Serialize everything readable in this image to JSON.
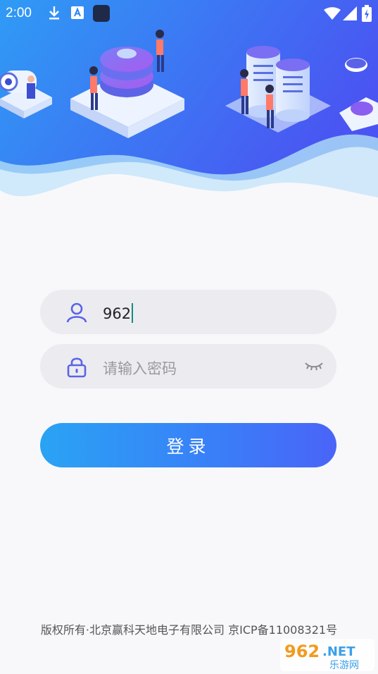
{
  "status_bar": {
    "time": "2:00",
    "icons": [
      "download-icon",
      "app-a-icon",
      "app-square-icon",
      "wifi-icon",
      "signal-icon",
      "battery-icon"
    ]
  },
  "hero": {
    "gradient_start": "#2f9bf5",
    "gradient_end": "#4a54f2",
    "illustration": "isometric-data-center-illustration"
  },
  "login": {
    "username_value": "962",
    "password_placeholder": "请输入密码",
    "submit_label": "登录"
  },
  "footer": {
    "copyright": "版权所有·北京赢科天地电子有限公司 京ICP备11008321号"
  },
  "watermark": {
    "brand_main": "962.NET",
    "brand_sub": "乐游网"
  },
  "colors": {
    "accent": "#3a7ef8",
    "icon": "#5a63e8",
    "field_bg": "#ececf0",
    "page_bg": "#f8f8fa"
  }
}
